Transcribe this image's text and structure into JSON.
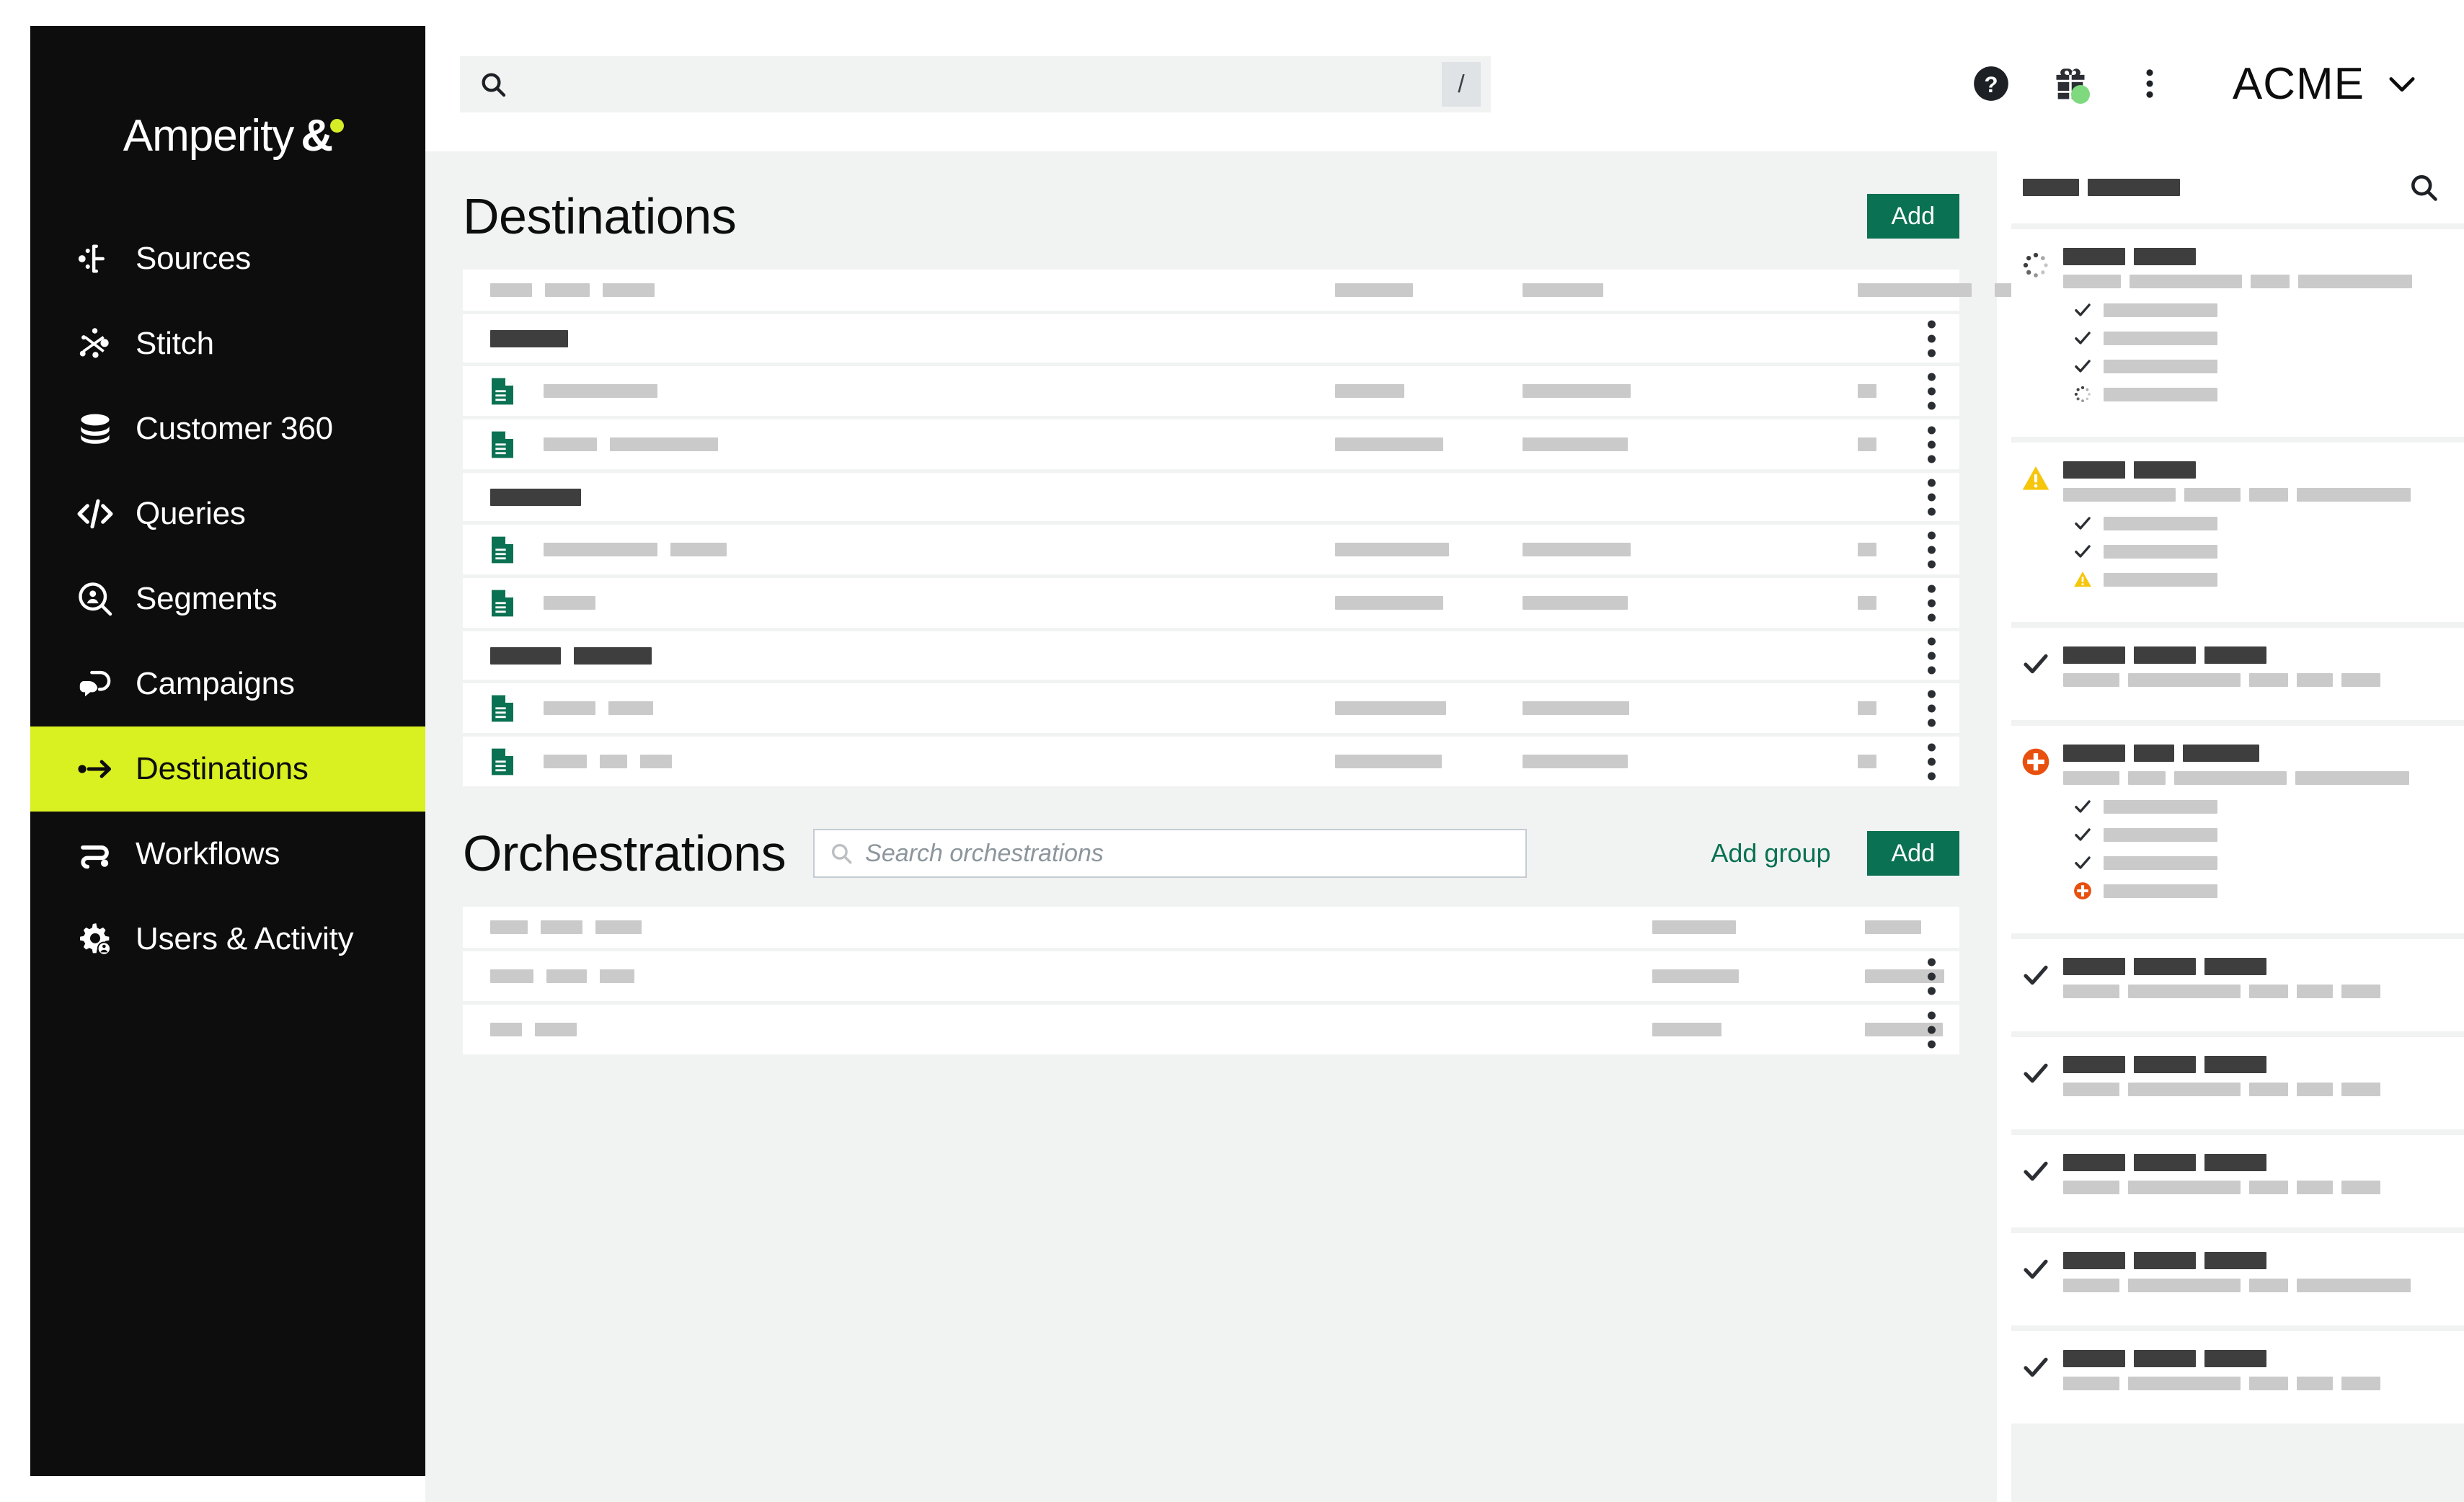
{
  "brand": {
    "logo_text": "Amperity",
    "logo_mark": "&",
    "accent_lime": "#d9f021",
    "accent_green": "#0a7152",
    "sidebar_bg": "#0d0d0d"
  },
  "sidebar": {
    "items": [
      {
        "label": "Sources",
        "icon": "sources-icon",
        "active": false
      },
      {
        "label": "Stitch",
        "icon": "stitch-icon",
        "active": false
      },
      {
        "label": "Customer 360",
        "icon": "database-icon",
        "active": false
      },
      {
        "label": "Queries",
        "icon": "code-icon",
        "active": false
      },
      {
        "label": "Segments",
        "icon": "segments-icon",
        "active": false
      },
      {
        "label": "Campaigns",
        "icon": "campaigns-icon",
        "active": false
      },
      {
        "label": "Destinations",
        "icon": "destinations-icon",
        "active": true
      },
      {
        "label": "Workflows",
        "icon": "workflows-icon",
        "active": false
      },
      {
        "label": "Users & Activity",
        "icon": "users-icon",
        "active": false
      }
    ]
  },
  "topbar": {
    "search": {
      "value": "",
      "placeholder": "",
      "icon": "search-icon",
      "shortcut": "/"
    },
    "help_icon": "help-circle-icon",
    "gift_icon": "gift-icon",
    "gift_badge_color": "#7fd97f",
    "more_icon": "kebab-menu-icon",
    "tenant": "ACME",
    "tenant_chevron": "chevron-down-icon"
  },
  "destinations": {
    "title": "Destinations",
    "add_label": "Add",
    "header_cells": [
      {
        "w": 58
      },
      {
        "w": 62
      },
      {
        "w": 72
      }
    ],
    "header_cols": [
      {
        "w": 108
      },
      {
        "w": 112
      },
      {
        "w": 158
      },
      {
        "w": 82
      }
    ],
    "rows": [
      {
        "type": "group",
        "bars": [
          {
            "w": 108,
            "shade": "dark"
          }
        ]
      },
      {
        "type": "item",
        "icon": "document-icon",
        "name": [
          {
            "w": 158
          }
        ],
        "col2": [
          {
            "w": 96
          }
        ],
        "col3": [
          {
            "w": 150
          }
        ],
        "dash": true
      },
      {
        "type": "item",
        "icon": "document-icon",
        "name": [
          {
            "w": 74
          },
          {
            "w": 150
          }
        ],
        "col2": [
          {
            "w": 150
          }
        ],
        "col3": [
          {
            "w": 146
          }
        ],
        "dash": true
      },
      {
        "type": "group",
        "bars": [
          {
            "w": 126,
            "shade": "dark"
          }
        ]
      },
      {
        "type": "item",
        "icon": "document-icon",
        "name": [
          {
            "w": 158
          },
          {
            "w": 78
          }
        ],
        "col2": [
          {
            "w": 158
          }
        ],
        "col3": [
          {
            "w": 150
          }
        ],
        "dash": true
      },
      {
        "type": "item",
        "icon": "document-icon",
        "name": [
          {
            "w": 72
          }
        ],
        "col2": [
          {
            "w": 150
          }
        ],
        "col3": [
          {
            "w": 146
          }
        ],
        "dash": true
      },
      {
        "type": "group",
        "bars": [
          {
            "w": 98,
            "shade": "dark"
          },
          {
            "w": 108,
            "shade": "dark"
          }
        ]
      },
      {
        "type": "item",
        "icon": "document-icon",
        "name": [
          {
            "w": 72
          },
          {
            "w": 62
          }
        ],
        "col2": [
          {
            "w": 154
          }
        ],
        "col3": [
          {
            "w": 148
          }
        ],
        "dash": true
      },
      {
        "type": "item",
        "icon": "document-icon",
        "name": [
          {
            "w": 60
          },
          {
            "w": 38
          },
          {
            "w": 44
          }
        ],
        "col2": [
          {
            "w": 148
          }
        ],
        "col3": [
          {
            "w": 146
          }
        ],
        "dash": true
      }
    ]
  },
  "orchestrations": {
    "title": "Orchestrations",
    "search": {
      "value": "",
      "placeholder": "Search orchestrations",
      "icon": "search-icon"
    },
    "add_group_label": "Add group",
    "add_label": "Add",
    "header_name": [
      {
        "w": 52
      },
      {
        "w": 58
      },
      {
        "w": 64
      }
    ],
    "header_cols": [
      {
        "w": 116
      },
      {
        "w": 78
      },
      {
        "w": 118
      },
      {
        "w": 54
      }
    ],
    "rows": [
      {
        "name": [
          {
            "w": 60
          },
          {
            "w": 56
          },
          {
            "w": 48
          }
        ],
        "cols": [
          {
            "w": 120
          },
          {
            "w": 110
          },
          {
            "w": 144
          }
        ]
      },
      {
        "name": [
          {
            "w": 44
          },
          {
            "w": 58
          }
        ],
        "cols": [
          {
            "w": 96
          },
          {
            "w": 108
          },
          {
            "w": 118
          }
        ]
      }
    ]
  },
  "activity_panel": {
    "header_bars": [
      {
        "w": 78
      },
      {
        "w": 128
      }
    ],
    "search_icon": "search-icon",
    "status_colors": {
      "running": "#3e3e3e",
      "warning": "#f6c60d",
      "success": "#2b2f33",
      "error": "#e8500f"
    },
    "cards": [
      {
        "status": "spinner-icon",
        "title_bars": [
          {
            "w": 86
          },
          {
            "w": 86
          }
        ],
        "meta_bars": [
          {
            "w": 80
          },
          {
            "w": 156
          },
          {
            "w": 54
          },
          {
            "w": 158
          }
        ],
        "tasks": [
          {
            "status": "check-icon",
            "w": 158
          },
          {
            "status": "check-icon",
            "w": 158
          },
          {
            "status": "check-icon",
            "w": 158
          },
          {
            "status": "spinner-icon",
            "w": 158
          }
        ],
        "footer_bar": {
          "w": 156
        }
      },
      {
        "status": "warning-icon",
        "title_bars": [
          {
            "w": 86
          },
          {
            "w": 86
          }
        ],
        "meta_bars": [
          {
            "w": 156
          },
          {
            "w": 78
          },
          {
            "w": 54
          },
          {
            "w": 158
          }
        ],
        "tasks": [
          {
            "status": "check-icon",
            "w": 158
          },
          {
            "status": "check-icon",
            "w": 158
          },
          {
            "status": "warning-icon",
            "w": 158
          }
        ],
        "footer_bar": {
          "w": 156
        }
      },
      {
        "status": "check-icon",
        "title_bars": [
          {
            "w": 86
          },
          {
            "w": 86
          },
          {
            "w": 86
          }
        ],
        "meta_bars": [
          {
            "w": 78
          },
          {
            "w": 156
          },
          {
            "w": 54
          },
          {
            "w": 50
          },
          {
            "w": 54
          }
        ],
        "tasks": [],
        "footer_bar": {
          "w": 156
        }
      },
      {
        "status": "error-icon",
        "title_bars": [
          {
            "w": 86
          },
          {
            "w": 56
          },
          {
            "w": 106
          }
        ],
        "meta_bars": [
          {
            "w": 78
          },
          {
            "w": 52
          },
          {
            "w": 156
          },
          {
            "w": 158
          }
        ],
        "tasks": [
          {
            "status": "check-icon",
            "w": 158
          },
          {
            "status": "check-icon",
            "w": 158
          },
          {
            "status": "check-icon",
            "w": 158
          },
          {
            "status": "error-icon",
            "w": 158
          }
        ],
        "footer_bar": {
          "w": 156
        }
      },
      {
        "status": "check-icon",
        "title_bars": [
          {
            "w": 86
          },
          {
            "w": 86
          },
          {
            "w": 86
          }
        ],
        "meta_bars": [
          {
            "w": 78
          },
          {
            "w": 156
          },
          {
            "w": 54
          },
          {
            "w": 50
          },
          {
            "w": 54
          }
        ],
        "tasks": [],
        "footer_bar": {
          "w": 156
        }
      },
      {
        "status": "check-icon",
        "title_bars": [
          {
            "w": 86
          },
          {
            "w": 86
          },
          {
            "w": 86
          }
        ],
        "meta_bars": [
          {
            "w": 78
          },
          {
            "w": 156
          },
          {
            "w": 54
          },
          {
            "w": 50
          },
          {
            "w": 54
          }
        ],
        "tasks": [],
        "footer_bar": {
          "w": 156
        }
      },
      {
        "status": "check-icon",
        "title_bars": [
          {
            "w": 86
          },
          {
            "w": 86
          },
          {
            "w": 86
          }
        ],
        "meta_bars": [
          {
            "w": 78
          },
          {
            "w": 156
          },
          {
            "w": 54
          },
          {
            "w": 50
          },
          {
            "w": 54
          }
        ],
        "tasks": [],
        "footer_bar": {
          "w": 156
        }
      },
      {
        "status": "check-icon",
        "title_bars": [
          {
            "w": 86
          },
          {
            "w": 86
          },
          {
            "w": 86
          }
        ],
        "meta_bars": [
          {
            "w": 78
          },
          {
            "w": 156
          },
          {
            "w": 54
          },
          {
            "w": 158
          }
        ],
        "tasks": [],
        "footer_bar": {
          "w": 156
        }
      },
      {
        "status": "check-icon",
        "title_bars": [
          {
            "w": 86
          },
          {
            "w": 86
          },
          {
            "w": 86
          }
        ],
        "meta_bars": [
          {
            "w": 78
          },
          {
            "w": 156
          },
          {
            "w": 54
          },
          {
            "w": 50
          },
          {
            "w": 54
          }
        ],
        "tasks": [],
        "footer_bar": {
          "w": 156
        }
      }
    ]
  }
}
